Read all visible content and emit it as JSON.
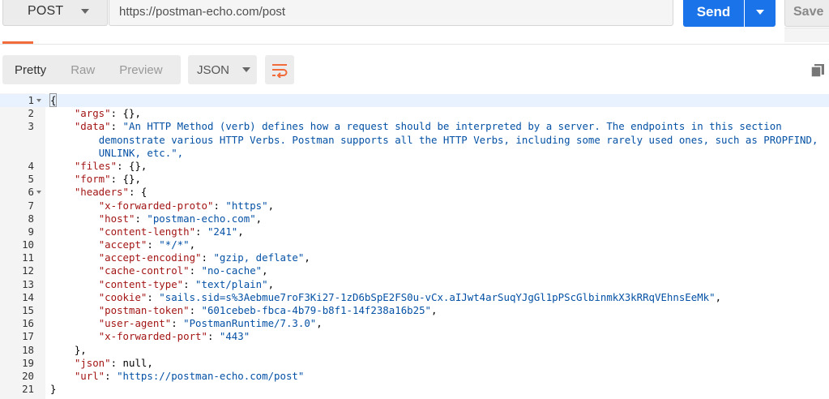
{
  "request": {
    "method": "POST",
    "url": "https://postman-echo.com/post",
    "send_label": "Send",
    "save_label": "Save"
  },
  "response": {
    "view_tabs": [
      "Pretty",
      "Raw",
      "Preview"
    ],
    "active_tab": "Pretty",
    "format": "JSON"
  },
  "code": {
    "line_numbers": [
      "1",
      "2",
      "3",
      "4",
      "5",
      "6",
      "7",
      "8",
      "9",
      "10",
      "11",
      "12",
      "13",
      "14",
      "15",
      "16",
      "17",
      "18",
      "19",
      "20",
      "21"
    ],
    "foldable_lines": [
      "1",
      "6"
    ],
    "data_text": "\"An HTTP Method (verb) defines how a request should be interpreted by a server. The endpoints in this section demonstrate various HTTP Verbs. Postman supports all the HTTP Verbs, including some rarely used ones, such as PROPFIND, UNLINK, etc.\"",
    "data_text_lines": [
      "\"An HTTP Method (verb) defines how a request should be interpreted by a server. The endpoints in this section",
      "demonstrate various HTTP Verbs. Postman supports all the HTTP Verbs, including some rarely used ones, such as PROPFIND,",
      "UNLINK, etc.\","
    ],
    "keys": {
      "args": "\"args\"",
      "data": "\"data\"",
      "files": "\"files\"",
      "form": "\"form\"",
      "headers": "\"headers\"",
      "json": "\"json\"",
      "url": "\"url\""
    },
    "headers": [
      {
        "key": "\"x-forwarded-proto\"",
        "value": "\"https\""
      },
      {
        "key": "\"host\"",
        "value": "\"postman-echo.com\""
      },
      {
        "key": "\"content-length\"",
        "value": "\"241\""
      },
      {
        "key": "\"accept\"",
        "value": "\"*/*\""
      },
      {
        "key": "\"accept-encoding\"",
        "value": "\"gzip, deflate\""
      },
      {
        "key": "\"cache-control\"",
        "value": "\"no-cache\""
      },
      {
        "key": "\"content-type\"",
        "value": "\"text/plain\""
      },
      {
        "key": "\"cookie\"",
        "value": "\"sails.sid=s%3Aebmue7roF3Ki27-1zD6bSpE2FS0u-vCx.aIJwt4arSuqYJgGl1pPScGlbinmkX3kRRqVEhnsEeMk\""
      },
      {
        "key": "\"postman-token\"",
        "value": "\"601cebeb-fbca-4b79-b8f1-14f238a16b25\""
      },
      {
        "key": "\"user-agent\"",
        "value": "\"PostmanRuntime/7.3.0\""
      },
      {
        "key": "\"x-forwarded-port\"",
        "value": "\"443\""
      }
    ],
    "json_value": "null",
    "url_value": "\"https://postman-echo.com/post\""
  },
  "icons": {
    "method_caret": "chevron-down-icon",
    "send_caret": "chevron-down-icon",
    "format_caret": "chevron-down-icon",
    "wrap": "wrap-lines-icon",
    "copy": "copy-icon"
  },
  "colors": {
    "accent": "#1a73e8",
    "tab_indicator": "#f26b3a",
    "wrap_icon": "#f26b3a",
    "json_key": "#a31515",
    "json_string": "#0451a5"
  }
}
